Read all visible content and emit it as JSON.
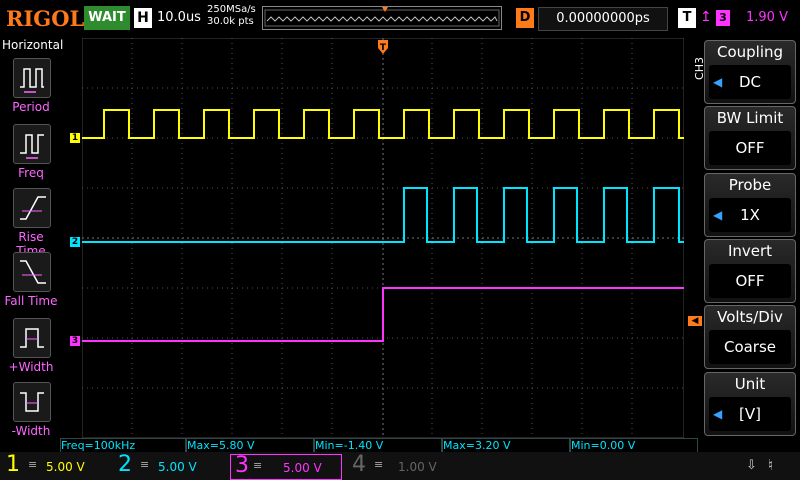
{
  "header": {
    "brand": "RIGOL",
    "run_status": "WAIT",
    "horizontal_label": "H",
    "timebase": "10.0us",
    "sample_rate": "250MSa/s",
    "memory_depth": "30.0k pts",
    "delay_label": "D",
    "delay_value": "0.00000000ps",
    "trigger_label": "T",
    "trigger_source": "3",
    "trigger_level": "1.90 V"
  },
  "left_menu": {
    "title": "Horizontal",
    "items": [
      {
        "label": "Period",
        "icon": "period-icon"
      },
      {
        "label": "Freq",
        "icon": "frequency-icon"
      },
      {
        "label": "Rise Time",
        "icon": "rise-time-icon"
      },
      {
        "label": "Fall Time",
        "icon": "fall-time-icon"
      },
      {
        "label": "+Width",
        "icon": "positive-width-icon"
      },
      {
        "label": "-Width",
        "icon": "negative-width-icon"
      }
    ]
  },
  "right_menu": {
    "channel_tag": "CH3",
    "items": [
      {
        "label": "Coupling",
        "value": "DC"
      },
      {
        "label": "BW Limit",
        "value": "OFF"
      },
      {
        "label": "Probe",
        "value": "1X"
      },
      {
        "label": "Invert",
        "value": "OFF"
      },
      {
        "label": "Volts/Div",
        "value": "Coarse"
      },
      {
        "label": "Unit",
        "value": "[V]"
      }
    ]
  },
  "measurements": [
    {
      "text": "Freq=100kHz"
    },
    {
      "text": "Max=5.80 V"
    },
    {
      "text": "Min=-1.40 V"
    },
    {
      "text": "Max=3.20 V"
    },
    {
      "text": "Min=0.00 V"
    }
  ],
  "channels": [
    {
      "num": "1",
      "scale": "5.00 V",
      "color": "#ffff00",
      "active": true
    },
    {
      "num": "2",
      "scale": "5.00 V",
      "color": "#00e5ff",
      "active": true
    },
    {
      "num": "3",
      "scale": "5.00 V",
      "color": "#ff33ff",
      "active": true
    },
    {
      "num": "4",
      "scale": "1.00 V",
      "color": "#666666",
      "active": false
    }
  ],
  "trace_markers": {
    "ch1": "1",
    "ch2": "2",
    "ch3": "3",
    "trigger": "T"
  },
  "colors": {
    "ch1": "#ffff00",
    "ch2": "#00e5ff",
    "ch3": "#ff33ff",
    "trigger": "#ff7a1a",
    "accent": "#3aa0ff"
  }
}
